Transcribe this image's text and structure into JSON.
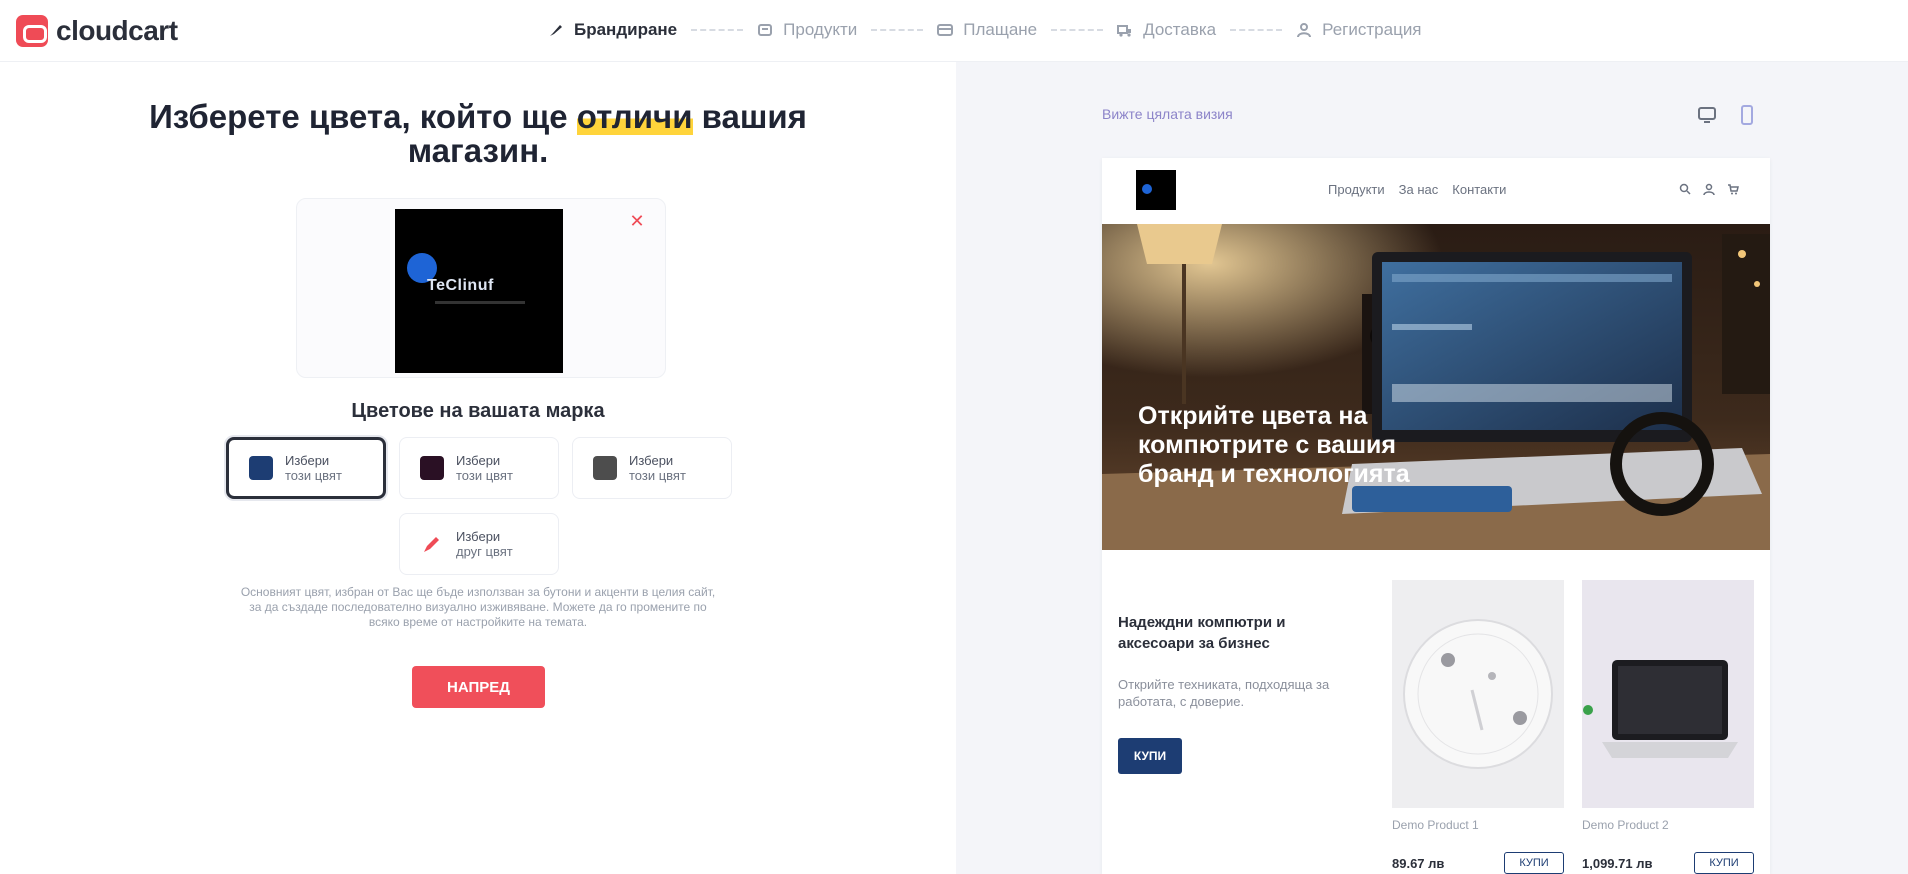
{
  "app": {
    "logo_text": "cloudcart"
  },
  "steps": [
    {
      "label": "Брандиране",
      "icon": "brush-icon",
      "active": true
    },
    {
      "label": "Продукти",
      "icon": "tag-icon",
      "active": false
    },
    {
      "label": "Плащане",
      "icon": "card-icon",
      "active": false
    },
    {
      "label": "Доставка",
      "icon": "truck-icon",
      "active": false
    },
    {
      "label": "Регистрация",
      "icon": "user-icon",
      "active": false
    }
  ],
  "left": {
    "heading_before": "Изберете цвета, който ще ",
    "heading_highlight": "отличи",
    "heading_after": " вашия магазин.",
    "logo_preview_text": "TeClinuf",
    "subheading": "Цветове на вашата марка",
    "swatches": [
      {
        "color": "#1d3d73",
        "line1": "Избери",
        "line2": "този цвят",
        "selected": true
      },
      {
        "color": "#2a1024",
        "line1": "Избери",
        "line2": "този цвят",
        "selected": false
      },
      {
        "color": "#4d4d4d",
        "line1": "Избери",
        "line2": "този цвят",
        "selected": false
      },
      {
        "color": "#ef4b56",
        "line1": "Избери",
        "line2": "друг цвят",
        "selected": false,
        "custom": true
      }
    ],
    "help_text": "Основният цвят, избран от Вас ще бъде използван за бутони и акценти в целия сайт, за да създаде последователно визуално изживяване. Можете да го промените по всяко време от настройките на темата.",
    "next_label": "НАПРЕД"
  },
  "right": {
    "preview_link": "Вижте цялата визия",
    "site": {
      "nav": [
        "Продукти",
        "За нас",
        "Контакти"
      ],
      "hero_title": "Открийте цвета на компютрите с вашия бранд и технологията",
      "promo_title": "Надеждни компютри и аксесоари за бизнес",
      "promo_text": "Открийте техниката, подходяща за работата, с доверие.",
      "promo_button": "КУПИ",
      "products": [
        {
          "name": "Demo Product 1",
          "price": "89.67 лв",
          "add": "КУПИ"
        },
        {
          "name": "Demo Product 2",
          "price": "1,099.71 лв",
          "add": "КУПИ"
        }
      ]
    }
  },
  "colors": {
    "accent": "#f04f5a",
    "brand_primary": "#1d3d73",
    "panel_bg": "#f4f5f9"
  }
}
